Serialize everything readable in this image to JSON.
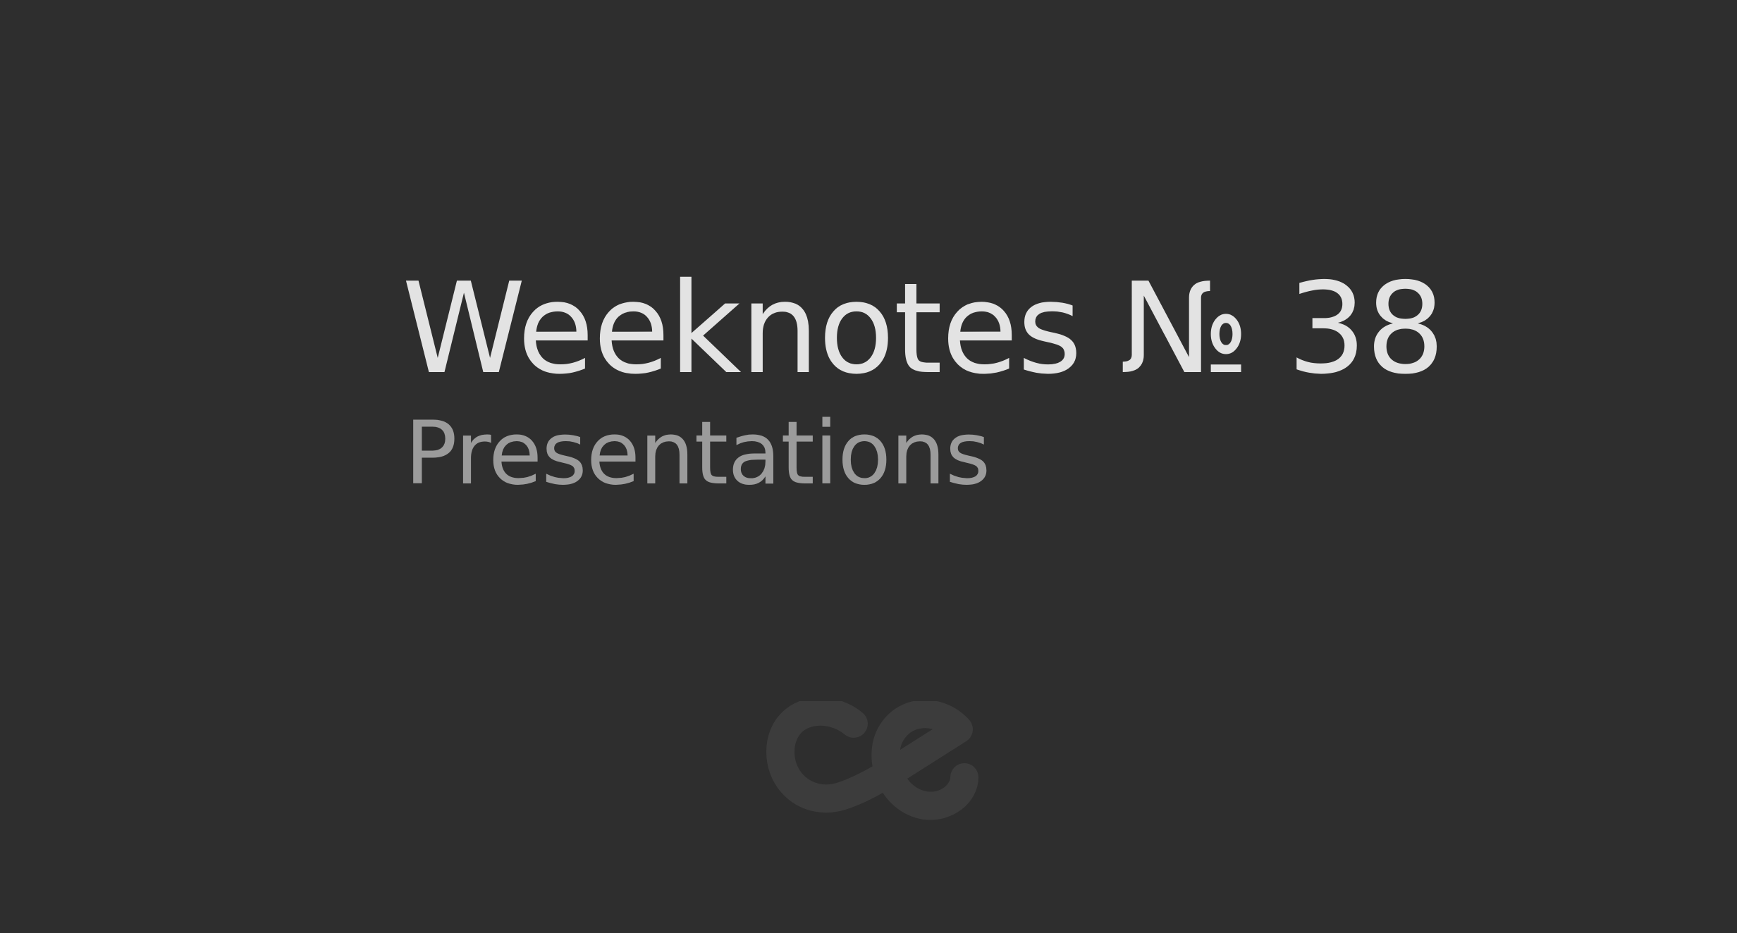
{
  "slide": {
    "title": "Weeknotes № 38",
    "subtitle": "Presentations"
  },
  "logo": {
    "name": "ce-logo",
    "text": "ce"
  },
  "colors": {
    "background": "#2e2e2e",
    "title": "#e3e3e3",
    "subtitle": "#9b9b9b",
    "logo": "#3c3c3c"
  }
}
